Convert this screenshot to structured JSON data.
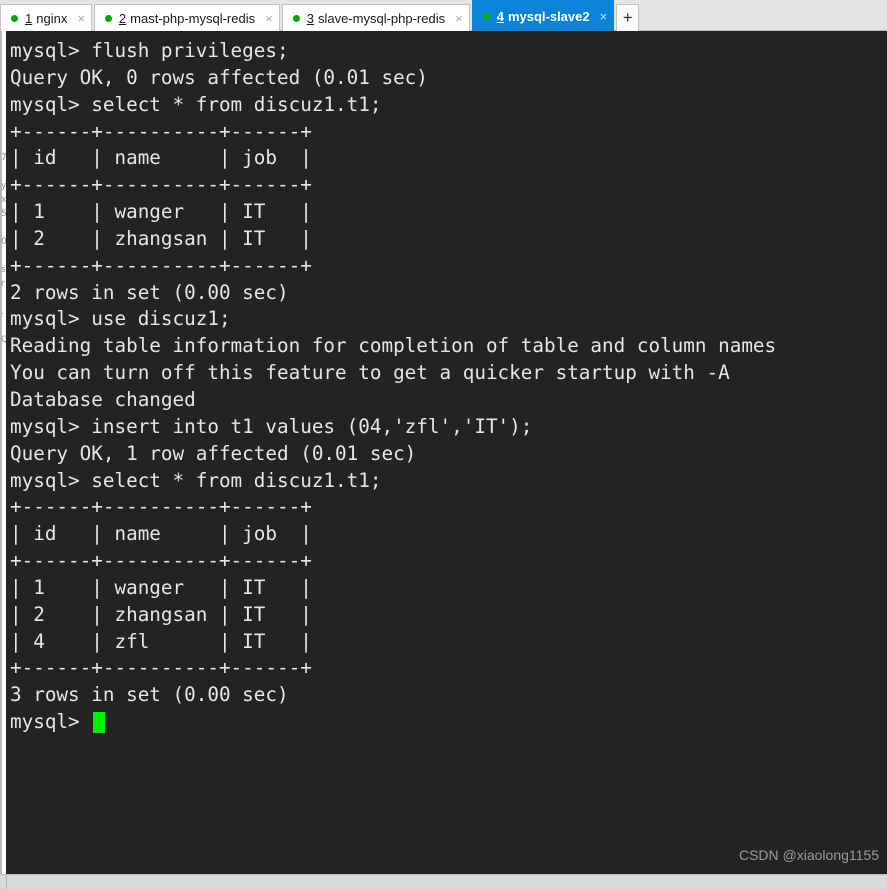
{
  "window": {
    "title": "mysql-slave2"
  },
  "tabbar": {
    "add_tab_label": "+",
    "close_glyph": "×",
    "tabs": [
      {
        "number": "1",
        "label": "nginx",
        "status": "connected",
        "active": false
      },
      {
        "number": "2",
        "label": "mast-php-mysql-redis",
        "status": "connected",
        "active": false
      },
      {
        "number": "3",
        "label": "slave-mysql-php-redis",
        "status": "connected",
        "active": false
      },
      {
        "number": "4",
        "label": "mysql-slave2",
        "status": "connected",
        "active": true
      }
    ]
  },
  "behind_panel": {
    "ghost_text": "7\n\ny\nx\n5\n\n0\n\ns\nr\n\n.\n\nQ"
  },
  "terminal": {
    "background_color": "#232323",
    "text_color": "#e6e6e6",
    "cursor_color": "#00ee00",
    "lines": [
      "mysql> flush privileges;",
      "Query OK, 0 rows affected (0.01 sec)",
      "",
      "mysql> select * from discuz1.t1;",
      "+------+----------+------+",
      "| id   | name     | job  |",
      "+------+----------+------+",
      "| 1    | wanger   | IT   |",
      "| 2    | zhangsan | IT   |",
      "+------+----------+------+",
      "2 rows in set (0.00 sec)",
      "",
      "mysql> use discuz1;",
      "Reading table information for completion of table and column names",
      "You can turn off this feature to get a quicker startup with -A",
      "",
      "Database changed",
      "mysql> insert into t1 values (04,'zfl','IT');",
      "Query OK, 1 row affected (0.01 sec)",
      "",
      "mysql> select * from discuz1.t1;",
      "+------+----------+------+",
      "| id   | name     | job  |",
      "+------+----------+------+",
      "| 1    | wanger   | IT   |",
      "| 2    | zhangsan | IT   |",
      "| 4    | zfl      | IT   |",
      "+------+----------+------+",
      "3 rows in set (0.00 sec)",
      ""
    ],
    "prompt": "mysql> ",
    "watermark": "CSDN @xiaolong1155"
  },
  "tables": [
    {
      "columns": [
        "id",
        "name",
        "job"
      ],
      "rows": [
        [
          "1",
          "wanger",
          "IT"
        ],
        [
          "2",
          "zhangsan",
          "IT"
        ]
      ],
      "result_text": "2 rows in set (0.00 sec)"
    },
    {
      "columns": [
        "id",
        "name",
        "job"
      ],
      "rows": [
        [
          "1",
          "wanger",
          "IT"
        ],
        [
          "2",
          "zhangsan",
          "IT"
        ],
        [
          "4",
          "zfl",
          "IT"
        ]
      ],
      "result_text": "3 rows in set (0.00 sec)"
    }
  ],
  "colors": {
    "active_tab": "#0a84d8",
    "tab_dot": "#00a700",
    "terminal_bg": "#232323",
    "cursor": "#00ee00"
  }
}
